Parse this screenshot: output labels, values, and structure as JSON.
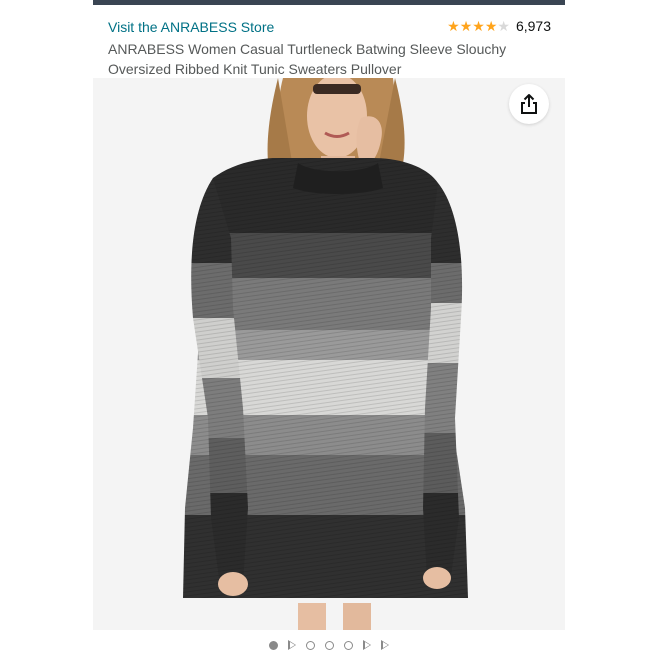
{
  "store": {
    "link_text": "Visit the ANRABESS Store"
  },
  "rating": {
    "stars": 4.2,
    "count_text": "6,973",
    "star_color": "#FFA41C"
  },
  "product": {
    "title": "ANRABESS Women Casual Turtleneck Batwing Sleeve Slouchy Oversized Ribbed Knit Tunic Sweaters Pullover"
  },
  "gallery": {
    "share_icon": "share-icon",
    "indicators": [
      "dot-active",
      "video",
      "dot",
      "dot",
      "dot",
      "video",
      "video"
    ]
  },
  "colors": {
    "link": "#007185",
    "title": "#565959",
    "topbar": "#3a4553"
  }
}
